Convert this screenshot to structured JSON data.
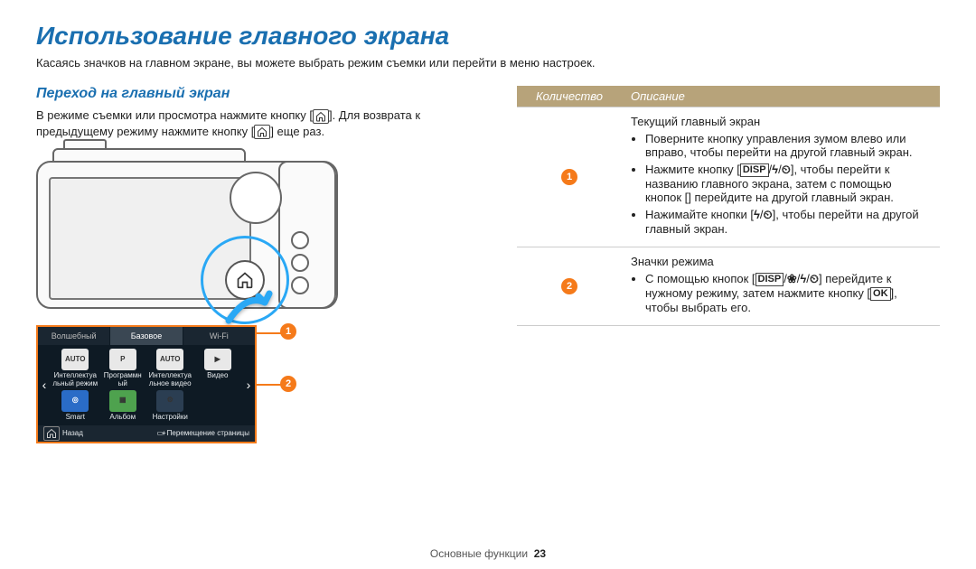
{
  "title": "Использование главного экрана",
  "intro": "Касаясь значков на главном экране, вы можете выбрать режим съемки или перейти в меню настроек.",
  "left": {
    "subtitle": "Переход на главный экран",
    "body_pre": "В режиме съемки или просмотра нажмите кнопку [",
    "body_mid": "]. Для возврата к предыдущему режиму нажмите кнопку [",
    "body_post": "] еще раз."
  },
  "screen": {
    "tabs": [
      "Волшебный",
      "Базовое",
      "Wi-Fi"
    ],
    "active_tab": 1,
    "row1": [
      {
        "icon": "AUTO",
        "label": "Интеллектуа льный режим"
      },
      {
        "icon": "P",
        "label": "Программн ый"
      },
      {
        "icon": "AUTO",
        "label": "Интеллектуа льное видео"
      },
      {
        "icon": "▶",
        "label": "Видео"
      }
    ],
    "row2": [
      {
        "icon": "◎",
        "label": "Smart",
        "cls": "blue"
      },
      {
        "icon": "▦",
        "label": "Альбом",
        "cls": "green"
      },
      {
        "icon": "⚙",
        "label": "Настройки",
        "cls": "dark"
      }
    ],
    "back_label": "Назад",
    "move_label": "Перемещение страницы"
  },
  "table": {
    "col1": "Количество",
    "col2": "Описание",
    "rows": [
      {
        "num": "1",
        "head": "Текущий главный экран",
        "items": [
          {
            "pre": "Поверните кнопку управления зумом влево или вправо, чтобы перейти на другой главный экран."
          },
          {
            "pre": "Нажмите кнопку [",
            "k1": "DISP",
            "mid": "], чтобы перейти к названию главного экрана, затем с помощью кнопок [",
            "k2": "ϟ",
            "k3": "⏲",
            "post": "] перейдите на другой главный экран."
          },
          {
            "pre": "Нажимайте кнопки [",
            "k2": "ϟ",
            "k3": "⏲",
            "post": "], чтобы перейти на другой главный экран."
          }
        ]
      },
      {
        "num": "2",
        "head": "Значки режима",
        "items": [
          {
            "pre": "С помощью кнопок [",
            "k1": "DISP",
            "k2": "❀",
            "k3": "ϟ",
            "k4": "⏲",
            "mid": "] перейдите к нужному режиму, затем нажмите кнопку [",
            "k5": "OK",
            "post": "], чтобы выбрать его."
          }
        ]
      }
    ]
  },
  "footer": {
    "section": "Основные функции",
    "page": "23"
  }
}
